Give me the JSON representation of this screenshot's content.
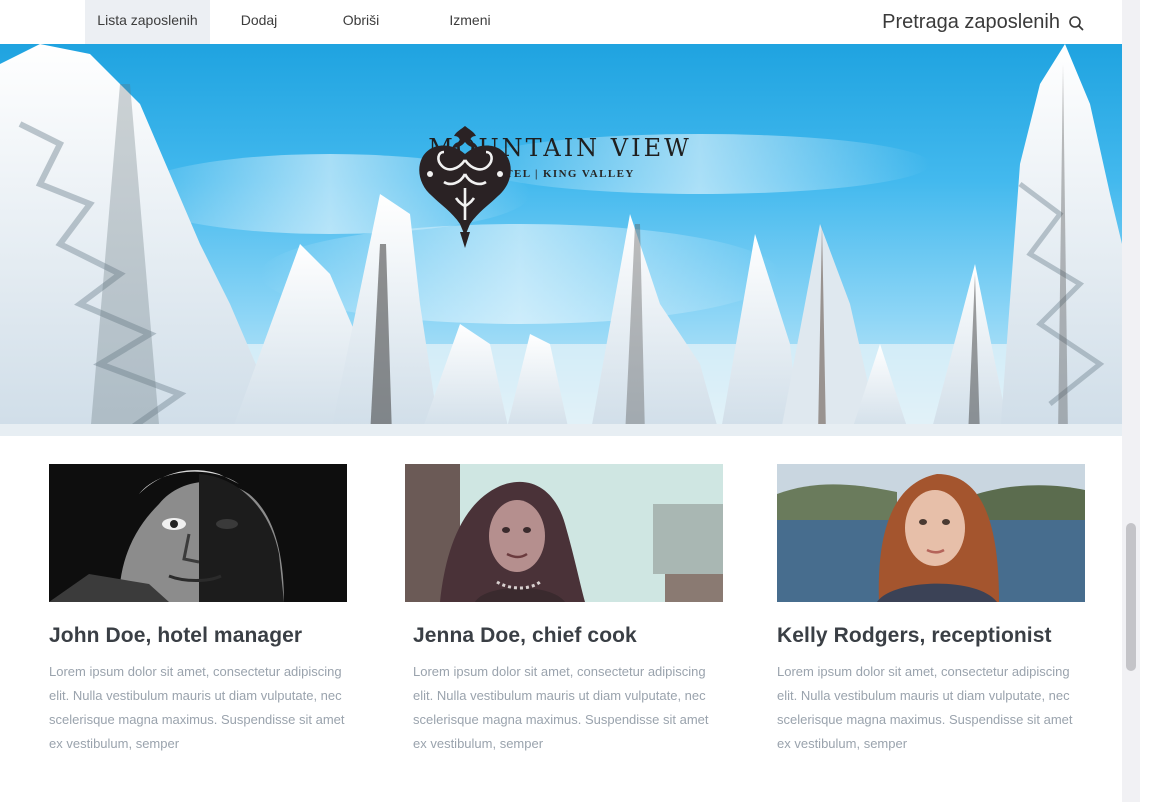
{
  "nav": {
    "tabs": [
      {
        "label": "Lista zaposlenih",
        "active": true
      },
      {
        "label": "Dodaj",
        "active": false
      },
      {
        "label": "Obriši",
        "active": false
      },
      {
        "label": "Izmeni",
        "active": false
      }
    ],
    "search_label": "Pretraga zaposlenih",
    "search_icon": "search-icon"
  },
  "hero": {
    "logo_title": "MOUNTAIN VIEW",
    "logo_subtitle": "HOTEL | KING VALLEY",
    "logo_icon": "ornamental-heart-logo"
  },
  "cards": [
    {
      "title": "John Doe, hotel manager",
      "text": "Lorem ipsum dolor sit amet, consectetur adipiscing elit. Nulla vestibulum mauris ut diam vulputate, nec scelerisque magna maximus. Suspendisse sit amet ex vestibulum, semper"
    },
    {
      "title": "Jenna Doe, chief cook",
      "text": "Lorem ipsum dolor sit amet, consectetur adipiscing elit. Nulla vestibulum mauris ut diam vulputate, nec scelerisque magna maximus. Suspendisse sit amet ex vestibulum, semper"
    },
    {
      "title": "Kelly Rodgers, receptionist",
      "text": "Lorem ipsum dolor sit amet, consectetur adipiscing elit. Nulla vestibulum mauris ut diam vulputate, nec scelerisque magna maximus. Suspendisse sit amet ex vestibulum, semper"
    }
  ],
  "colors": {
    "nav_active_bg": "#eceff3",
    "title_text": "#3a3f45",
    "body_text": "#9aa3ad",
    "sky": "#43b9ee"
  }
}
